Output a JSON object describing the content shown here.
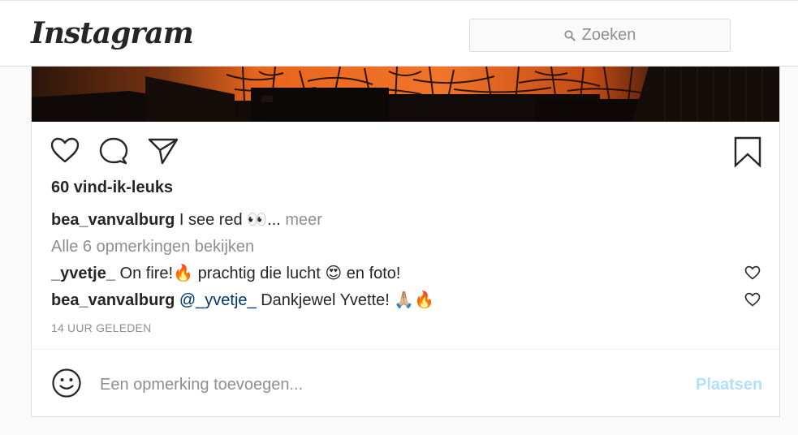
{
  "header": {
    "logo": "Instagram",
    "search_placeholder": "Zoeken"
  },
  "post": {
    "likes": "60 vind-ik-leuks",
    "caption": {
      "user": "bea_vanvalburg",
      "text": "I see red",
      "emoji": "👀",
      "ellipsis": "...",
      "more": "meer"
    },
    "view_comments": "Alle 6 opmerkingen bekijken",
    "comments": [
      {
        "user": "_yvetje_",
        "text_1": "On fire!",
        "emoji_1": "🔥",
        "text_2": "prachtig die lucht",
        "emoji_2": "😍",
        "text_3": "en foto!"
      },
      {
        "user": "bea_vanvalburg",
        "mention": "@_yvetje_",
        "text_1": "Dankjewel Yvette!",
        "emoji_1": "🙏🏼",
        "emoji_2": "🔥"
      }
    ],
    "timestamp": "14 UUR GELEDEN",
    "add_comment_placeholder": "Een opmerking toevoegen...",
    "post_button": "Plaatsen"
  },
  "icons": [
    "heart-icon",
    "comment-icon",
    "share-icon",
    "bookmark-icon",
    "search-icon",
    "smiley-icon"
  ],
  "colors": {
    "text": "#262626",
    "muted": "#8e8e8e",
    "mention": "#00376b",
    "post_button_disabled": "#b2dffc",
    "sky_fire": "#e2641a"
  }
}
